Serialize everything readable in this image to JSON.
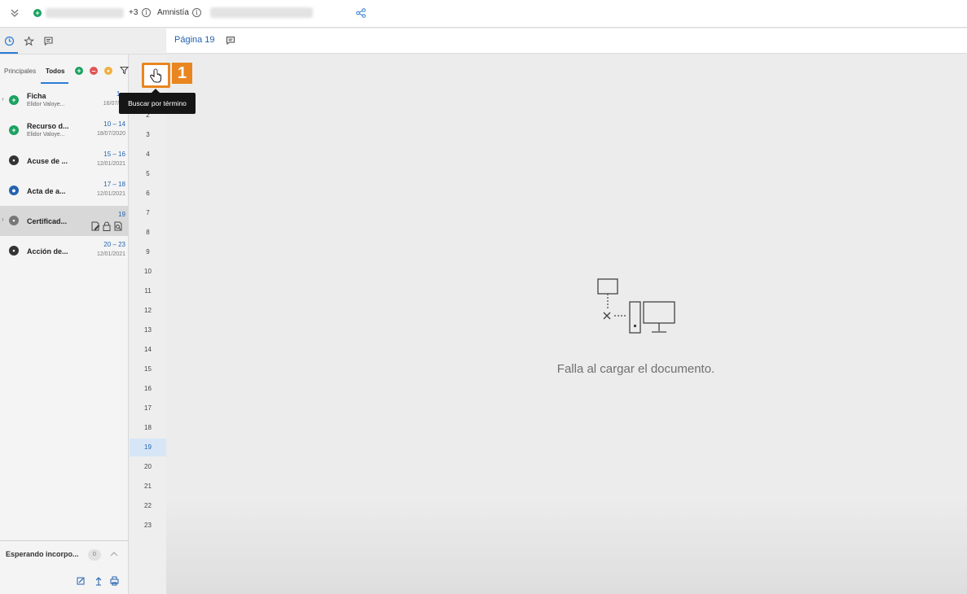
{
  "topbar": {
    "extra_count": "+3",
    "label": "Amnistía"
  },
  "left_filters": {
    "tab_main": "Principales",
    "tab_all": "Todos"
  },
  "documents": [
    {
      "title": "Ficha",
      "author": "Elidor Valoye...",
      "range": "1 –",
      "date": "16/07/20",
      "icon": "add-circle-icon",
      "expandable": true
    },
    {
      "title": "Recurso d...",
      "author": "Elidor Valoye...",
      "range": "10 – 14",
      "date": "18/07/2020",
      "icon": "add-circle-icon",
      "expandable": false
    },
    {
      "title": "Acuse de ...",
      "author": "",
      "range": "15 – 16",
      "date": "12/01/2021",
      "icon": "document-icon",
      "expandable": false
    },
    {
      "title": "Acta de a...",
      "author": "",
      "range": "17 – 18",
      "date": "12/01/2021",
      "icon": "person-icon",
      "expandable": false
    },
    {
      "title": "Certificad...",
      "author": "",
      "range": "19",
      "date": "",
      "icon": "document-icon",
      "expandable": true,
      "selected": true
    },
    {
      "title": "Acción de...",
      "author": "",
      "range": "20 – 23",
      "date": "12/01/2021",
      "icon": "document-icon",
      "expandable": false
    }
  ],
  "pages": [
    "2",
    "3",
    "4",
    "5",
    "6",
    "7",
    "8",
    "9",
    "10",
    "11",
    "12",
    "13",
    "14",
    "15",
    "16",
    "17",
    "18",
    "19",
    "20",
    "21",
    "22",
    "23"
  ],
  "active_page": "19",
  "waiting": {
    "label": "Esperando incorpo...",
    "count": "0"
  },
  "viewer": {
    "page_label": "Página 19",
    "error_message": "Falla al cargar el documento."
  },
  "tutorial": {
    "step": "1",
    "tooltip": "Buscar por término"
  },
  "colors": {
    "accent": "#2462b0",
    "highlight": "#e9861f",
    "success": "#1aa260"
  }
}
